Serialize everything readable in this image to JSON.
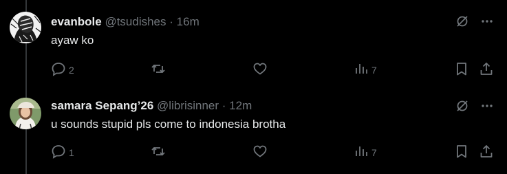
{
  "replies": [
    {
      "display_name": "evanbole",
      "handle": "@tsudishes",
      "separator": "·",
      "time": "16m",
      "text": "ayaw ko",
      "reply_count": "2",
      "views": "7"
    },
    {
      "display_name": "samara Sepang’26",
      "handle": "@librisinner",
      "separator": "·",
      "time": "12m",
      "text": "u sounds stupid pls come to indonesia brotha",
      "reply_count": "1",
      "views": "7"
    }
  ],
  "icons": {
    "reply": "reply-icon",
    "repost": "repost-icon",
    "like": "like-icon",
    "views": "views-icon",
    "bookmark": "bookmark-icon",
    "share": "share-icon",
    "grok": "grok-icon",
    "more": "more-icon"
  },
  "colors": {
    "background": "#000000",
    "text": "#e7e9ea",
    "secondary": "#71767b",
    "thread_line": "#333639"
  }
}
